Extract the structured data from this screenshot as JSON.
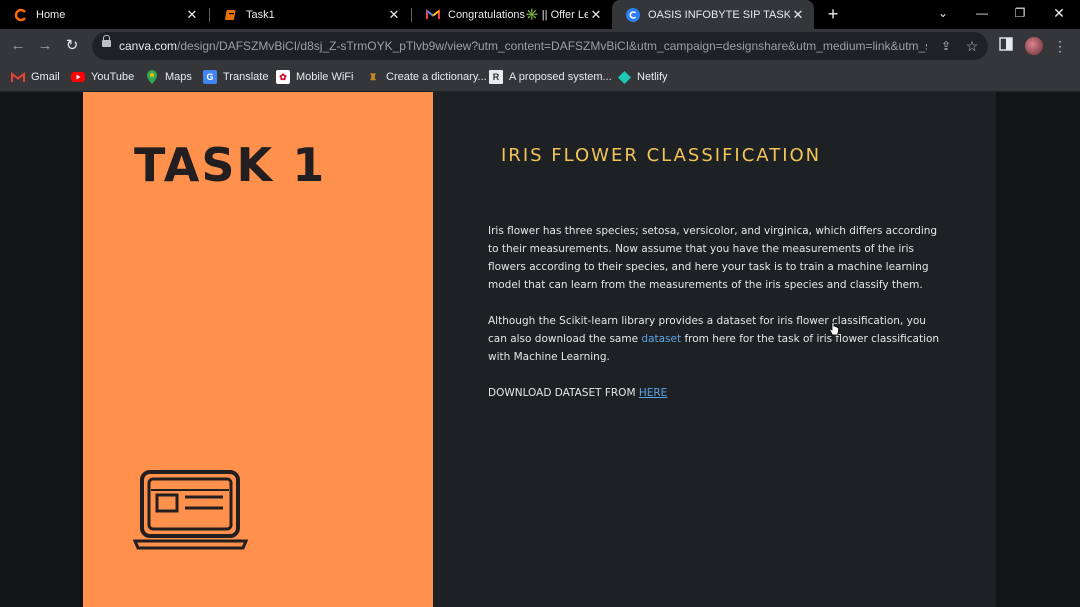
{
  "browser": {
    "tabs": [
      {
        "title": "Home",
        "icon": "canva-icon",
        "active": false
      },
      {
        "title": "Task1",
        "icon": "document-icon",
        "active": false
      },
      {
        "title": "Congratulations✳️ || Offer Letter",
        "icon": "gmail-icon",
        "active": false
      },
      {
        "title": "OASIS INFOBYTE SIP TASK LIST",
        "icon": "canva-c-icon",
        "active": true
      }
    ],
    "url_host": "canva.com",
    "url_rest": "/design/DAFSZMvBiCI/d8sj_Z-sTrmOYK_pTlvb9w/view?utm_content=DAFSZMvBiCI&utm_campaign=designshare&utm_medium=link&utm_sou...",
    "bookmarks": [
      {
        "label": "Gmail",
        "icon": "gmail-icon"
      },
      {
        "label": "YouTube",
        "icon": "youtube-icon"
      },
      {
        "label": "Maps",
        "icon": "maps-icon"
      },
      {
        "label": "Translate",
        "icon": "translate-icon"
      },
      {
        "label": "Mobile WiFi",
        "icon": "huawei-icon"
      },
      {
        "label": "Create a dictionary...",
        "icon": "bookmark-icon"
      },
      {
        "label": "A proposed system...",
        "icon": "researchgate-icon"
      },
      {
        "label": "Netlify",
        "icon": "netlify-icon"
      }
    ]
  },
  "slide": {
    "task_title": "TASK 1",
    "heading": "IRIS FLOWER CLASSIFICATION",
    "para1": "Iris flower has three species; setosa, versicolor, and virginica, which differs according to their measurements. Now assume that you have the measurements of the iris flowers according to their species, and here your task is to train a machine learning model that can learn from the measurements of the iris species and classify them.",
    "para2_before": "Although the Scikit-learn library provides a dataset for iris flower classification, you can also download the same ",
    "para2_link": "dataset",
    "para2_after": " from here for the task of iris flower classification with Machine Learning.",
    "download_text": "DOWNLOAD DATASET FROM ",
    "download_link": "HERE"
  },
  "colors": {
    "accent_orange": "#ff914d",
    "heading_yellow": "#f2c458",
    "link_blue": "#5ba4e6",
    "panel_dark": "#1e2124"
  }
}
